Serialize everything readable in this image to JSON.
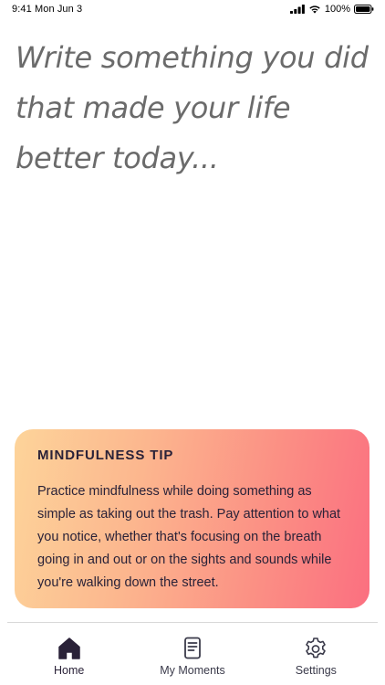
{
  "status_bar": {
    "time_date": "9:41 Mon Jun 3",
    "battery": "100%"
  },
  "prompt": {
    "text": "Write something you did that made your life better today..."
  },
  "tip": {
    "title": "MINDFULNESS TIP",
    "body": "Practice mindfulness while doing something as simple as taking out the trash. Pay attention to what you notice, whether that's focusing on the breath going in and out or on the sights and sounds while you're walking down the street."
  },
  "tabs": [
    {
      "label": "Home",
      "icon": "home-icon",
      "active": true
    },
    {
      "label": "My Moments",
      "icon": "document-icon",
      "active": false
    },
    {
      "label": "Settings",
      "icon": "gear-icon",
      "active": false
    }
  ],
  "colors": {
    "prompt_text": "#6b6b6b",
    "tip_gradient_start": "#fdd49a",
    "tip_gradient_end": "#fb6f80",
    "tip_text": "#2a2238",
    "tab_icon_active": "#2a2238",
    "tab_icon_inactive": "#3a3a4a"
  }
}
